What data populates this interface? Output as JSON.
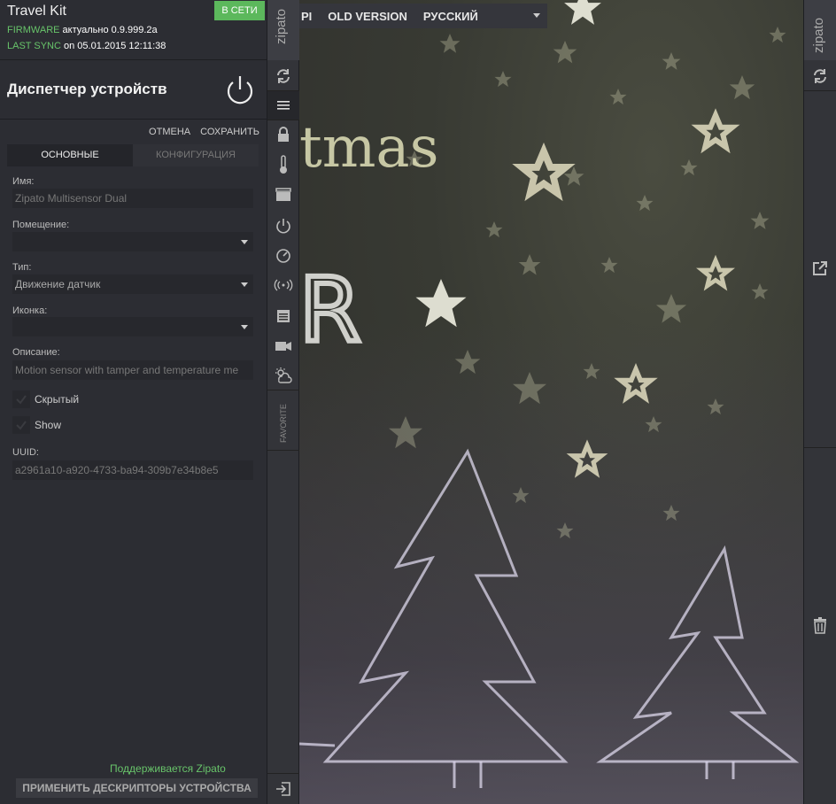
{
  "header": {
    "title": "Travel Kit",
    "status": "В СЕТИ",
    "firmware_label": "FIRMWARE",
    "firmware_value": "актуально 0.9.999.2a",
    "sync_label": "LAST SYNC",
    "sync_value": "on 05.01.2015 12:11:38"
  },
  "device_manager": {
    "title": "Диспетчер устройств",
    "cancel": "ОТМЕНА",
    "save": "СОХРАНИТЬ",
    "tabs": [
      {
        "label": "ОСНОВНЫЕ",
        "active": true
      },
      {
        "label": "КОНФИГУРАЦИЯ",
        "active": false
      }
    ]
  },
  "form": {
    "name_label": "Имя:",
    "name_value": "Zipato Multisensor Dual",
    "room_label": "Помещение:",
    "room_value": "",
    "type_label": "Тип:",
    "type_value": "Движение датчик",
    "icon_label": "Иконка:",
    "icon_value": "",
    "desc_label": "Описание:",
    "desc_value": "Motion sensor with tamper and temperature me",
    "hidden_label": "Скрытый",
    "show_label": "Show",
    "uuid_label": "UUID:",
    "uuid_value": "a2961a10-a920-4733-ba94-309b7e34b8e5"
  },
  "footer": {
    "supported": "Поддерживается Zipato",
    "apply_button": "ПРИМЕНИТЬ ДЕСКРИПТОРЫ УСТРОЙСТВА"
  },
  "sidebar": {
    "logo": "zipato",
    "favorite": "FAVORITE",
    "icons": [
      "refresh-icon",
      "menu-icon",
      "lock-icon",
      "thermometer-icon",
      "clapperboard-icon",
      "power-icon",
      "gauge-icon",
      "wireless-icon",
      "calendar-icon",
      "camera-icon",
      "weather-icon",
      "logout-icon"
    ]
  },
  "topbar": {
    "items": [
      "PI",
      "OLD VERSION",
      "РУССКИЙ"
    ]
  },
  "right_sidebar": {
    "logo": "zipato",
    "icons": [
      "refresh-icon",
      "external-link-icon",
      "trash-icon"
    ]
  },
  "colors": {
    "accent_green": "#5cb85c",
    "panel": "#2c2d33"
  }
}
